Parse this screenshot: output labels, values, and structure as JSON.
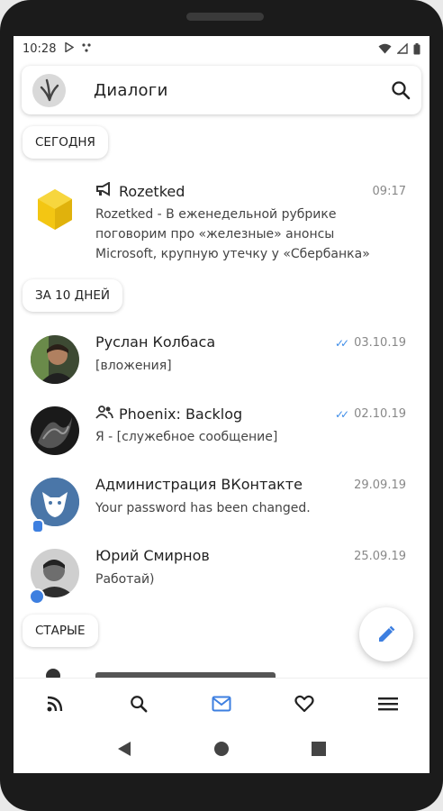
{
  "status_bar": {
    "time": "10:28"
  },
  "header": {
    "title": "Диалоги"
  },
  "sections": {
    "today": "СЕГОДНЯ",
    "last10": "ЗА 10 ДНЕЙ",
    "old": "СТАРЫЕ"
  },
  "dialogs": [
    {
      "name": "Rozetked",
      "date": "09:17",
      "message_lines": [
        "Rozetked - В еженедельной рубрике",
        "поговорим про «железные» анонсы",
        "Microsoft, крупную утечку у «Сбербанка»"
      ],
      "icon": "megaphone-icon"
    },
    {
      "name": "Руслан Колбаса",
      "date": "03.10.19",
      "message": "[вложения]",
      "read_icon": "double-check-icon"
    },
    {
      "name": "Phoenix: Backlog",
      "date": "02.10.19",
      "message": "Я - [служебное сообщение]",
      "read_icon": "double-check-icon",
      "icon": "group-icon"
    },
    {
      "name": "Администрация ВКонтакте",
      "date": "29.09.19",
      "message": "Your password has been changed."
    },
    {
      "name": "Юрий Смирнов",
      "date": "25.09.19",
      "message": "Работай)"
    }
  ],
  "colors": {
    "accent": "#3d7fe0",
    "rozetked_logo": "#f3c613",
    "vk_admin_avatar": "#4a76a8"
  },
  "bottom_nav": [
    "feed-icon",
    "search-icon",
    "mail-icon",
    "heart-icon",
    "menu-icon"
  ]
}
